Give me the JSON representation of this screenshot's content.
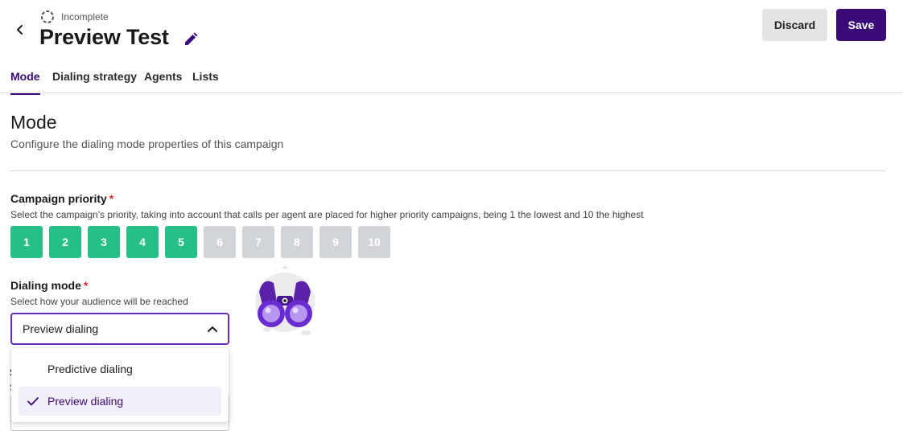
{
  "header": {
    "status": "Incomplete",
    "title": "Preview Test",
    "discard_label": "Discard",
    "save_label": "Save"
  },
  "tabs": [
    {
      "label": "Mode",
      "active": true
    },
    {
      "label": "Dialing strategy",
      "active": false
    },
    {
      "label": "Agents",
      "active": false
    },
    {
      "label": "Lists",
      "active": false
    }
  ],
  "section": {
    "title": "Mode",
    "subtitle": "Configure the dialing mode properties of this campaign"
  },
  "priority": {
    "label": "Campaign priority",
    "required_mark": "*",
    "help": "Select the campaign's priority, taking into account that calls per agent are placed for higher priority campaigns, being 1 the lowest and 10 the highest",
    "options": [
      "1",
      "2",
      "3",
      "4",
      "5",
      "6",
      "7",
      "8",
      "9",
      "10"
    ],
    "selected_value": 5
  },
  "dialing_mode": {
    "label": "Dialing mode",
    "required_mark": "*",
    "help": "Select how your audience will be reached",
    "value": "Preview dialing",
    "options": [
      {
        "label": "Predictive dialing",
        "selected": false
      },
      {
        "label": "Preview dialing",
        "selected": true
      }
    ]
  },
  "behind_fragment": {
    "label_letter": "S",
    "help_letter": "S"
  },
  "colors": {
    "brand": "#3a0a78",
    "priority_on": "#26bf86",
    "priority_off": "#d1d5d8",
    "required": "#d32f2f"
  }
}
